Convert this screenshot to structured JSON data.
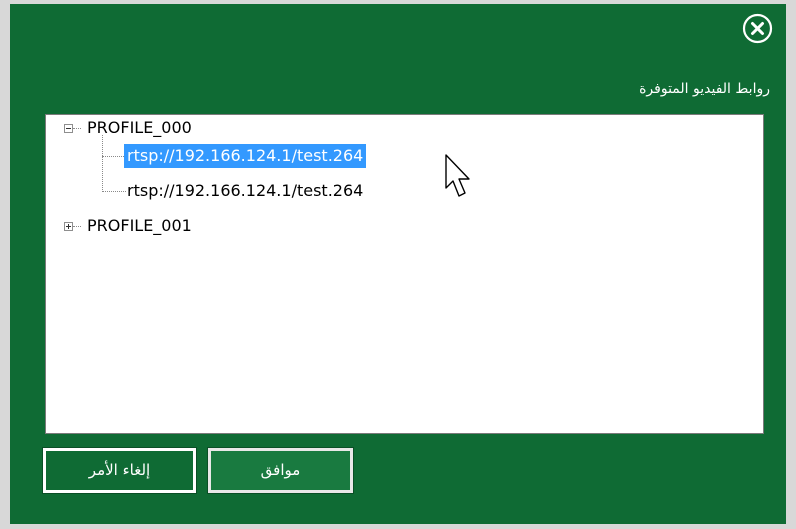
{
  "dialog": {
    "section_label": "روابط الفيديو المتوفرة",
    "close_icon": "close-circle-icon"
  },
  "tree": {
    "nodes": [
      {
        "label": "PROFILE_000",
        "expanded": true,
        "level": 0
      },
      {
        "label": "rtsp://192.166.124.1/test.264",
        "selected": true,
        "level": 1
      },
      {
        "label": "rtsp://192.166.124.1/test.264",
        "selected": false,
        "level": 1
      },
      {
        "label": "PROFILE_001",
        "expanded": false,
        "level": 0
      }
    ]
  },
  "buttons": {
    "ok_label": "موافق",
    "cancel_label": "إلغاء الأمر"
  },
  "colors": {
    "background": "#0f6b34",
    "selection": "#3399ff",
    "frame": "#d8d8d8"
  }
}
